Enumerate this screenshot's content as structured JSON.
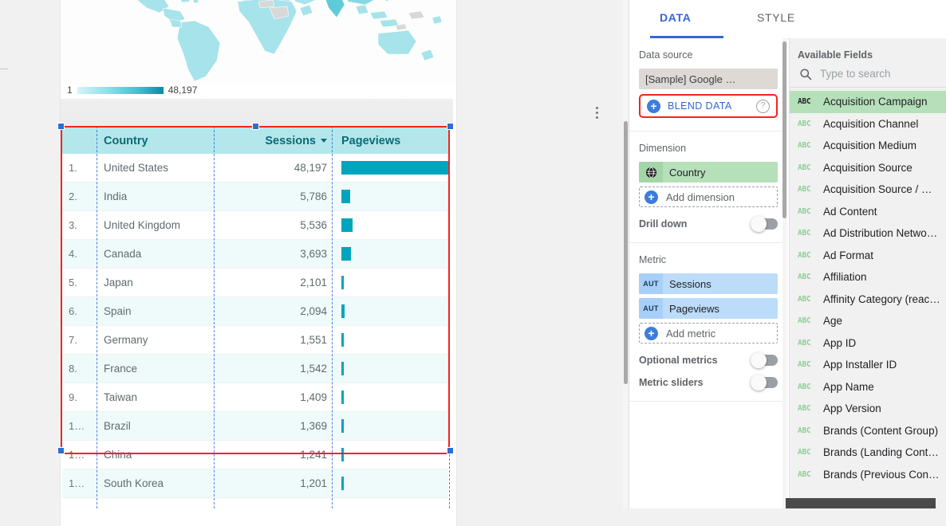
{
  "canvas": {
    "map": {
      "name": "world-geo-map",
      "legend_min": "1",
      "legend_max": "48,197"
    },
    "chart_menu": "more-options",
    "table": {
      "columns": [
        "",
        "Country",
        "Sessions",
        "Pageviews"
      ],
      "sort_column": "Sessions",
      "rows": [
        {
          "idx": "1.",
          "country": "United States",
          "sessions": "48,197",
          "pageviews_pct": 100
        },
        {
          "idx": "2.",
          "country": "India",
          "sessions": "5,786",
          "pageviews_pct": 8
        },
        {
          "idx": "3.",
          "country": "United Kingdom",
          "sessions": "5,536",
          "pageviews_pct": 10
        },
        {
          "idx": "4.",
          "country": "Canada",
          "sessions": "3,693",
          "pageviews_pct": 9
        },
        {
          "idx": "5.",
          "country": "Japan",
          "sessions": "2,101",
          "pageviews_pct": 2.5
        },
        {
          "idx": "6.",
          "country": "Spain",
          "sessions": "2,094",
          "pageviews_pct": 3
        },
        {
          "idx": "7.",
          "country": "Germany",
          "sessions": "1,551",
          "pageviews_pct": 2
        },
        {
          "idx": "8.",
          "country": "France",
          "sessions": "1,542",
          "pageviews_pct": 2
        },
        {
          "idx": "9.",
          "country": "Taiwan",
          "sessions": "1,409",
          "pageviews_pct": 2
        },
        {
          "idx": "1…",
          "country": "Brazil",
          "sessions": "1,369",
          "pageviews_pct": 2
        },
        {
          "idx": "1…",
          "country": "China",
          "sessions": "1,241",
          "pageviews_pct": 2
        },
        {
          "idx": "1…",
          "country": "South Korea",
          "sessions": "1,201",
          "pageviews_pct": 2
        }
      ]
    }
  },
  "panel": {
    "tabs": [
      {
        "label": "DATA",
        "active": true
      },
      {
        "label": "STYLE",
        "active": false
      }
    ],
    "data_source": {
      "label": "Data source",
      "value": "[Sample] Google …",
      "blend_label": "BLEND DATA",
      "help": "?"
    },
    "dimension": {
      "label": "Dimension",
      "chips": [
        {
          "icon": "globe-icon",
          "name": "Country"
        }
      ],
      "add_label": "Add dimension",
      "drill_down_label": "Drill down",
      "drill_down_on": false
    },
    "metric": {
      "label": "Metric",
      "chips": [
        {
          "icon": "AUT",
          "name": "Sessions"
        },
        {
          "icon": "AUT",
          "name": "Pageviews"
        }
      ],
      "add_label": "Add metric",
      "optional_metrics_label": "Optional metrics",
      "optional_metrics_on": false,
      "metric_sliders_label": "Metric sliders",
      "metric_sliders_on": false
    },
    "available_fields": {
      "title": "Available Fields",
      "search_placeholder": "Type to search",
      "search_value": "",
      "items": [
        {
          "type": "ABC",
          "name": "Acquisition Campaign",
          "selected": true
        },
        {
          "type": "ABC",
          "name": "Acquisition Channel",
          "selected": false
        },
        {
          "type": "ABC",
          "name": "Acquisition Medium",
          "selected": false
        },
        {
          "type": "ABC",
          "name": "Acquisition Source",
          "selected": false
        },
        {
          "type": "ABC",
          "name": "Acquisition Source / …",
          "selected": false
        },
        {
          "type": "ABC",
          "name": "Ad Content",
          "selected": false
        },
        {
          "type": "ABC",
          "name": "Ad Distribution Netwo…",
          "selected": false
        },
        {
          "type": "ABC",
          "name": "Ad Format",
          "selected": false
        },
        {
          "type": "ABC",
          "name": "Affiliation",
          "selected": false
        },
        {
          "type": "ABC",
          "name": "Affinity Category (reac…",
          "selected": false
        },
        {
          "type": "ABC",
          "name": "Age",
          "selected": false
        },
        {
          "type": "ABC",
          "name": "App ID",
          "selected": false
        },
        {
          "type": "ABC",
          "name": "App Installer ID",
          "selected": false
        },
        {
          "type": "ABC",
          "name": "App Name",
          "selected": false
        },
        {
          "type": "ABC",
          "name": "App Version",
          "selected": false
        },
        {
          "type": "ABC",
          "name": "Brands (Content Group)",
          "selected": false
        },
        {
          "type": "ABC",
          "name": "Brands (Landing Cont…",
          "selected": false
        },
        {
          "type": "ABC",
          "name": "Brands (Previous Con…",
          "selected": false
        }
      ]
    }
  },
  "colors": {
    "accent_blue": "#3367d6",
    "bar_teal": "#00a5bd",
    "header_cyan": "#b3e7ec",
    "dimension_green": "#b6e0b9",
    "metric_blue": "#bcdcfa",
    "highlight_red": "#f4241f"
  }
}
